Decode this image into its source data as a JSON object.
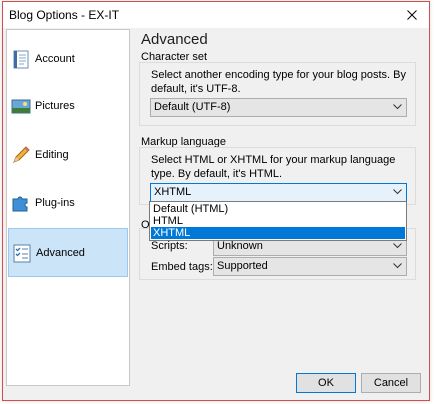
{
  "window": {
    "title": "Blog Options - EX-IT"
  },
  "sidebar": {
    "items": [
      {
        "label": "Account",
        "icon": "account-icon"
      },
      {
        "label": "Pictures",
        "icon": "pictures-icon"
      },
      {
        "label": "Editing",
        "icon": "editing-icon"
      },
      {
        "label": "Plug-ins",
        "icon": "plugins-icon"
      },
      {
        "label": "Advanced",
        "icon": "advanced-icon",
        "active": true
      }
    ]
  },
  "content": {
    "title": "Advanced",
    "charset": {
      "heading": "Character set",
      "description": "Select another encoding type for your blog posts. By default, it's UTF-8.",
      "selected": "Default (UTF-8)"
    },
    "markup": {
      "heading": "Markup language",
      "description": "Select HTML or XHTML for your markup language type. By default, it's HTML.",
      "selected": "XHTML",
      "options": [
        "Default (HTML)",
        "HTML",
        "XHTML"
      ],
      "highlighted_option": "XHTML"
    },
    "other": {
      "heading_partial": "O",
      "scripts_label": "Scripts:",
      "scripts_value": "Unknown",
      "embed_label": "Embed tags:",
      "embed_value": "Supported"
    }
  },
  "buttons": {
    "ok": "OK",
    "cancel": "Cancel"
  },
  "colors": {
    "accent": "#0078d7",
    "active_bg": "#cce4f7",
    "window_border": "#d24f4f"
  }
}
